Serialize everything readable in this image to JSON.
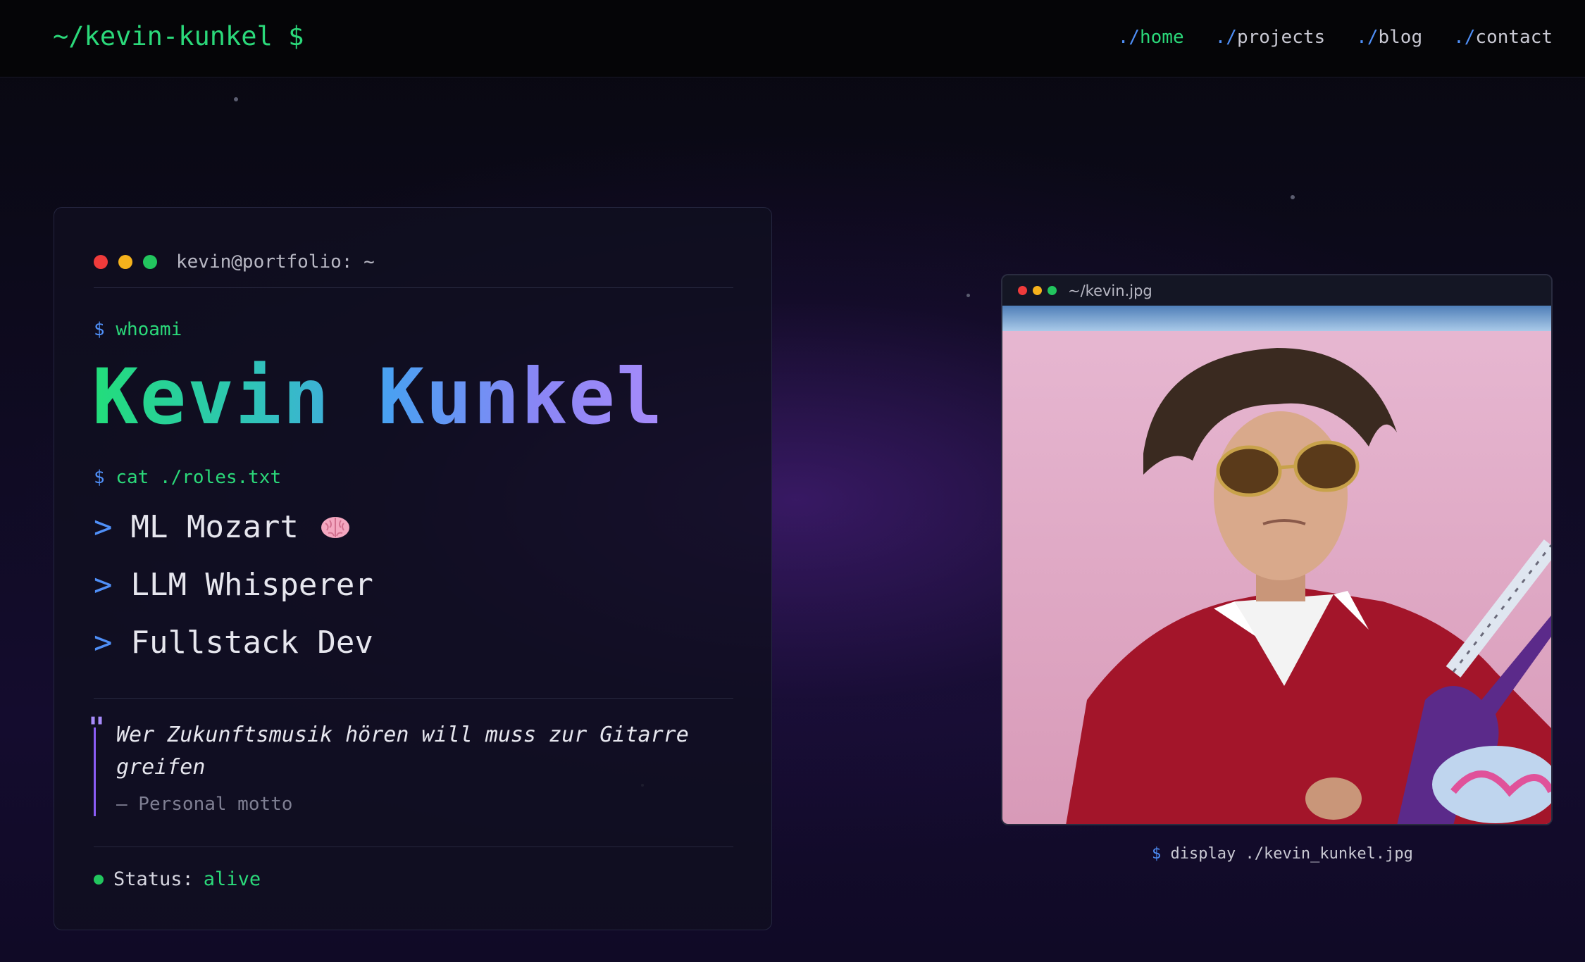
{
  "header": {
    "logo": "~/kevin-kunkel $",
    "nav": [
      {
        "prefix": "./",
        "label": "home",
        "active": true
      },
      {
        "prefix": "./",
        "label": "projects",
        "active": false
      },
      {
        "prefix": "./",
        "label": "blog",
        "active": false
      },
      {
        "prefix": "./",
        "label": "contact",
        "active": false
      }
    ]
  },
  "terminal": {
    "title": "kevin@portfolio: ~",
    "prompt": "$",
    "cmd_whoami": "whoami",
    "name": "Kevin Kunkel",
    "cmd_roles": "cat ./roles.txt",
    "role_marker": ">",
    "roles": [
      "ML Mozart",
      "LLM Whisperer",
      "Fullstack Dev"
    ],
    "role_icons": [
      "brain-emoji",
      "",
      ""
    ],
    "quote_mark": "\"",
    "quote": "Wer Zukunftsmusik hören will muss zur Gitarre greifen",
    "quote_attribution": "— Personal motto",
    "status_label": "Status:",
    "status_value": "alive"
  },
  "image_window": {
    "title": "~/kevin.jpg",
    "photo_alt": "portrait-photo",
    "caption_prompt": "$",
    "caption": "display ./kevin_kunkel.jpg"
  },
  "colors": {
    "accent_green": "#2bd97a",
    "accent_blue": "#4f8ff7",
    "accent_purple": "#a78bfa",
    "background": "#0f0b22"
  }
}
